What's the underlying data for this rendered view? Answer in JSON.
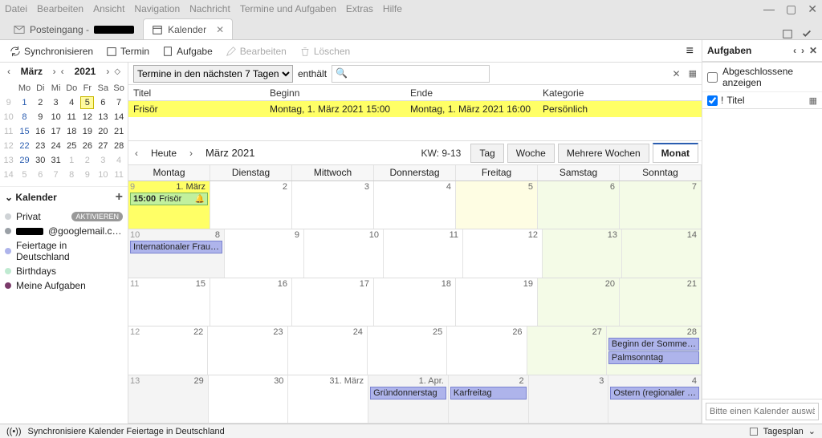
{
  "menubar": [
    "Datei",
    "Bearbeiten",
    "Ansicht",
    "Navigation",
    "Nachricht",
    "Termine und Aufgaben",
    "Extras",
    "Hilfe"
  ],
  "tabs": {
    "inbox": "Posteingang -",
    "calendar": "Kalender"
  },
  "toolbar": {
    "sync": "Synchronisieren",
    "termin": "Termin",
    "aufgabe": "Aufgabe",
    "bearbeiten": "Bearbeiten",
    "loeschen": "Löschen"
  },
  "tasks": {
    "title": "Aufgaben",
    "show_done": "Abgeschlossene anzeigen",
    "col_title": "Titel",
    "placeholder": "Bitte einen Kalender auswählen, der"
  },
  "minical": {
    "month": "März",
    "year": "2021",
    "dow": [
      "Mo",
      "Di",
      "Mi",
      "Do",
      "Fr",
      "Sa",
      "So"
    ],
    "rows": [
      {
        "wk": 9,
        "days": [
          {
            "n": 1,
            "c": "blue"
          },
          {
            "n": 2
          },
          {
            "n": 3
          },
          {
            "n": 4
          },
          {
            "n": 5,
            "c": "today"
          },
          {
            "n": 6
          },
          {
            "n": 7
          }
        ]
      },
      {
        "wk": 10,
        "days": [
          {
            "n": 8,
            "c": "blue"
          },
          {
            "n": 9
          },
          {
            "n": 10
          },
          {
            "n": 11
          },
          {
            "n": 12
          },
          {
            "n": 13
          },
          {
            "n": 14
          }
        ]
      },
      {
        "wk": 11,
        "days": [
          {
            "n": 15,
            "c": "blue"
          },
          {
            "n": 16
          },
          {
            "n": 17
          },
          {
            "n": 18
          },
          {
            "n": 19
          },
          {
            "n": 20
          },
          {
            "n": 21
          }
        ]
      },
      {
        "wk": 12,
        "days": [
          {
            "n": 22,
            "c": "blue"
          },
          {
            "n": 23
          },
          {
            "n": 24
          },
          {
            "n": 25
          },
          {
            "n": 26
          },
          {
            "n": 27
          },
          {
            "n": 28
          }
        ]
      },
      {
        "wk": 13,
        "days": [
          {
            "n": 29,
            "c": "blue"
          },
          {
            "n": 30
          },
          {
            "n": 31
          },
          {
            "n": 1,
            "c": "other"
          },
          {
            "n": 2,
            "c": "other"
          },
          {
            "n": 3,
            "c": "other"
          },
          {
            "n": 4,
            "c": "other"
          }
        ]
      },
      {
        "wk": 14,
        "days": [
          {
            "n": 5,
            "c": "other"
          },
          {
            "n": 6,
            "c": "other"
          },
          {
            "n": 7,
            "c": "other"
          },
          {
            "n": 8,
            "c": "other"
          },
          {
            "n": 9,
            "c": "other"
          },
          {
            "n": 10,
            "c": "other"
          },
          {
            "n": 11,
            "c": "other"
          }
        ]
      }
    ]
  },
  "calsection": {
    "header": "Kalender",
    "items": [
      {
        "label": "Privat",
        "color": "#cfd3d6",
        "badge": "AKTIVIEREN"
      },
      {
        "label": "@googlemail.c…",
        "color": "#9aa0a6",
        "redacted": true
      },
      {
        "label": "Feiertage in Deutschland",
        "color": "#aeb4eb"
      },
      {
        "label": "Birthdays",
        "color": "#bfead1"
      },
      {
        "label": "Meine Aufgaben",
        "color": "#7a3b6a"
      }
    ]
  },
  "filter": {
    "dropdown": "Termine in den nächsten 7 Tagen",
    "contains": "enthält"
  },
  "eventlist": {
    "headers": {
      "titel": "Titel",
      "beginn": "Beginn",
      "ende": "Ende",
      "kategorie": "Kategorie"
    },
    "rows": [
      {
        "titel": "Frisör",
        "beginn": "Montag, 1. März 2021 15:00",
        "ende": "Montag, 1. März 2021 16:00",
        "kategorie": "Persönlich"
      }
    ]
  },
  "calnav": {
    "heute": "Heute",
    "label": "März 2021",
    "kw": "KW: 9-13",
    "views": {
      "tag": "Tag",
      "woche": "Woche",
      "mwochen": "Mehrere Wochen",
      "monat": "Monat"
    }
  },
  "dayheaders": [
    "Montag",
    "Dienstag",
    "Mittwoch",
    "Donnerstag",
    "Freitag",
    "Samstag",
    "Sonntag"
  ],
  "weeks": [
    {
      "wn": 9,
      "cells": [
        {
          "num": "1. März",
          "cls": "ylw",
          "events": [
            {
              "time": "15:00",
              "title": "Frisör",
              "type": "own",
              "bell": true
            }
          ]
        },
        {
          "num": "2"
        },
        {
          "num": "3"
        },
        {
          "num": "4"
        },
        {
          "num": "5",
          "cls": "shade1"
        },
        {
          "num": "6",
          "cls": "shade2"
        },
        {
          "num": "7",
          "cls": "shade2"
        }
      ]
    },
    {
      "wn": 10,
      "cells": [
        {
          "num": "8",
          "cls": "past",
          "events": [
            {
              "title": "Internationaler Frau…",
              "type": "hol"
            }
          ]
        },
        {
          "num": "9"
        },
        {
          "num": "10"
        },
        {
          "num": "11"
        },
        {
          "num": "12"
        },
        {
          "num": "13",
          "cls": "shade2"
        },
        {
          "num": "14",
          "cls": "shade2"
        }
      ]
    },
    {
      "wn": 11,
      "cells": [
        {
          "num": "15"
        },
        {
          "num": "16"
        },
        {
          "num": "17"
        },
        {
          "num": "18"
        },
        {
          "num": "19"
        },
        {
          "num": "20",
          "cls": "shade2"
        },
        {
          "num": "21",
          "cls": "shade2"
        }
      ]
    },
    {
      "wn": 12,
      "cells": [
        {
          "num": "22"
        },
        {
          "num": "23"
        },
        {
          "num": "24"
        },
        {
          "num": "25"
        },
        {
          "num": "26"
        },
        {
          "num": "27",
          "cls": "shade2"
        },
        {
          "num": "28",
          "cls": "shade2",
          "events": [
            {
              "title": "Beginn der Somme…",
              "type": "hol"
            },
            {
              "title": "Palmsonntag",
              "type": "hol"
            }
          ]
        }
      ]
    },
    {
      "wn": 13,
      "cells": [
        {
          "num": "29",
          "cls": "past"
        },
        {
          "num": "30"
        },
        {
          "num": "31. März"
        },
        {
          "num": "1. Apr.",
          "cls": "past",
          "events": [
            {
              "title": "Gründonnerstag",
              "type": "hol"
            }
          ]
        },
        {
          "num": "2",
          "cls": "past",
          "events": [
            {
              "title": "Karfreitag",
              "type": "hol"
            }
          ]
        },
        {
          "num": "3",
          "cls": "past"
        },
        {
          "num": "4",
          "cls": "past",
          "events": [
            {
              "title": "Ostern (regionaler …",
              "type": "hol"
            }
          ]
        }
      ]
    }
  ],
  "statusbar": {
    "text": "Synchronisiere Kalender Feiertage in Deutschland",
    "right": "Tagesplan"
  }
}
